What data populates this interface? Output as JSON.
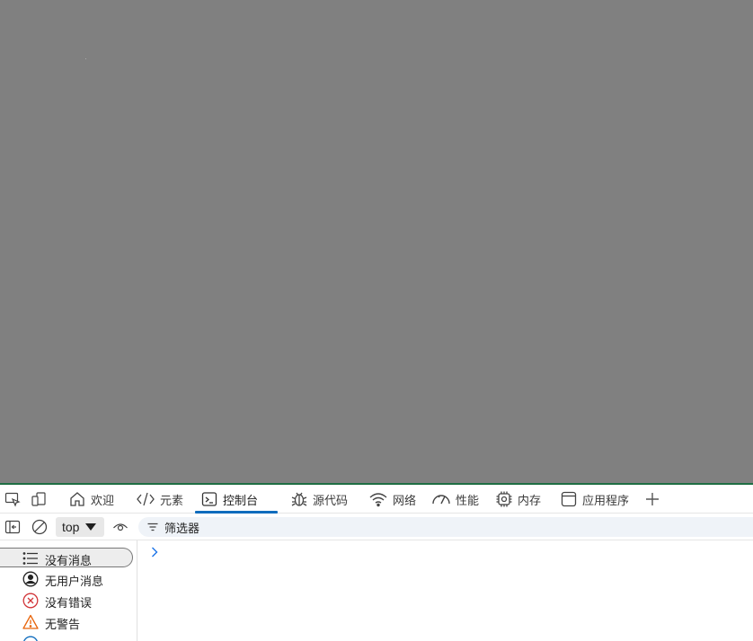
{
  "tabs": [
    {
      "label": "欢迎",
      "icon": "home-icon"
    },
    {
      "label": "元素",
      "icon": "code-icon"
    },
    {
      "label": "控制台",
      "icon": "console-icon",
      "active": true
    },
    {
      "label": "源代码",
      "icon": "bug-icon"
    },
    {
      "label": "网络",
      "icon": "wifi-icon"
    },
    {
      "label": "性能",
      "icon": "gauge-icon"
    },
    {
      "label": "内存",
      "icon": "chip-icon"
    },
    {
      "label": "应用程序",
      "icon": "window-icon"
    }
  ],
  "toolbar": {
    "context": "top",
    "filter_label": "筛选器"
  },
  "sidebar": {
    "items": [
      {
        "label": "没有消息",
        "icon": "list-icon",
        "selected": true
      },
      {
        "label": "无用户消息",
        "icon": "user-icon"
      },
      {
        "label": "没有错误",
        "icon": "error-icon"
      },
      {
        "label": "无警告",
        "icon": "warning-icon"
      }
    ]
  },
  "colors": {
    "viewport": "#808080",
    "accent": "#0f6cbd",
    "error": "#d13438",
    "warning": "#e8640b",
    "info": "#0f6cbd",
    "divider": "#1f6e43"
  }
}
